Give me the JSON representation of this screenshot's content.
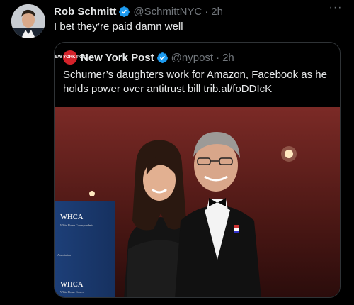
{
  "tweet": {
    "author_name": "Rob Schmitt",
    "author_handle": "@SchmittNYC",
    "separator": "·",
    "time": "2h",
    "text": "I bet they’re paid damn well",
    "more_label": "···"
  },
  "quote": {
    "author_name": "New York Post",
    "author_handle": "@nypost",
    "separator": "·",
    "time": "2h",
    "avatar_text": "NEW YORK POST",
    "text": "Schumer’s daughters work for Amazon, Facebook as he holds power over antitrust bill trib.al/foDDIcK",
    "media": {
      "banner_text_1": "WHCA",
      "banner_sub_1": "White House Correspondents",
      "banner_sub_2": "Association",
      "banner_text_2": "WHCA",
      "banner_sub_3": "White House Corres"
    }
  },
  "colors": {
    "background": "#000000",
    "text_primary": "#e7e9ea",
    "text_secondary": "#71767b",
    "verified_blue": "#1d9bf0",
    "border": "#2f3336",
    "nypost_red": "#d5222a"
  },
  "icons": {
    "verified": "verified-badge-icon",
    "more": "more-options-icon"
  }
}
